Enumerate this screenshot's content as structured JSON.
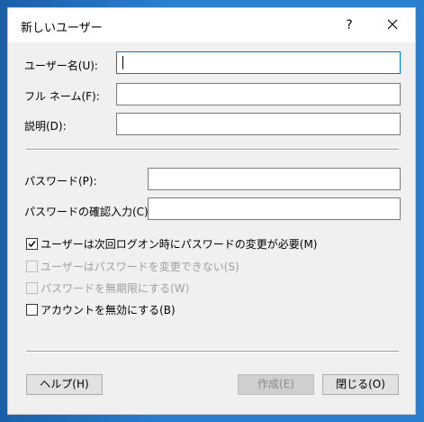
{
  "dialog": {
    "title": "新しいユーザー",
    "help_glyph": "?",
    "close_label": "close"
  },
  "fields": {
    "username_label": "ユーザー名(U):",
    "username_value": "",
    "fullname_label": "フル ネーム(F):",
    "fullname_value": "",
    "description_label": "説明(D):",
    "description_value": "",
    "password_label": "パスワード(P):",
    "password_value": "",
    "confirm_label": "パスワードの確認入力(C):",
    "confirm_value": ""
  },
  "options": [
    {
      "label": "ユーザーは次回ログオン時にパスワードの変更が必要(M)",
      "checked": true,
      "enabled": true
    },
    {
      "label": "ユーザーはパスワードを変更できない(S)",
      "checked": false,
      "enabled": false
    },
    {
      "label": "パスワードを無期限にする(W)",
      "checked": false,
      "enabled": false
    },
    {
      "label": "アカウントを無効にする(B)",
      "checked": false,
      "enabled": true
    }
  ],
  "buttons": {
    "help": "ヘルプ(H)",
    "create": "作成(E)",
    "close": "閉じる(O)"
  },
  "colors": {
    "accent": "#0078d7",
    "desktop": "#1f6fb8"
  }
}
